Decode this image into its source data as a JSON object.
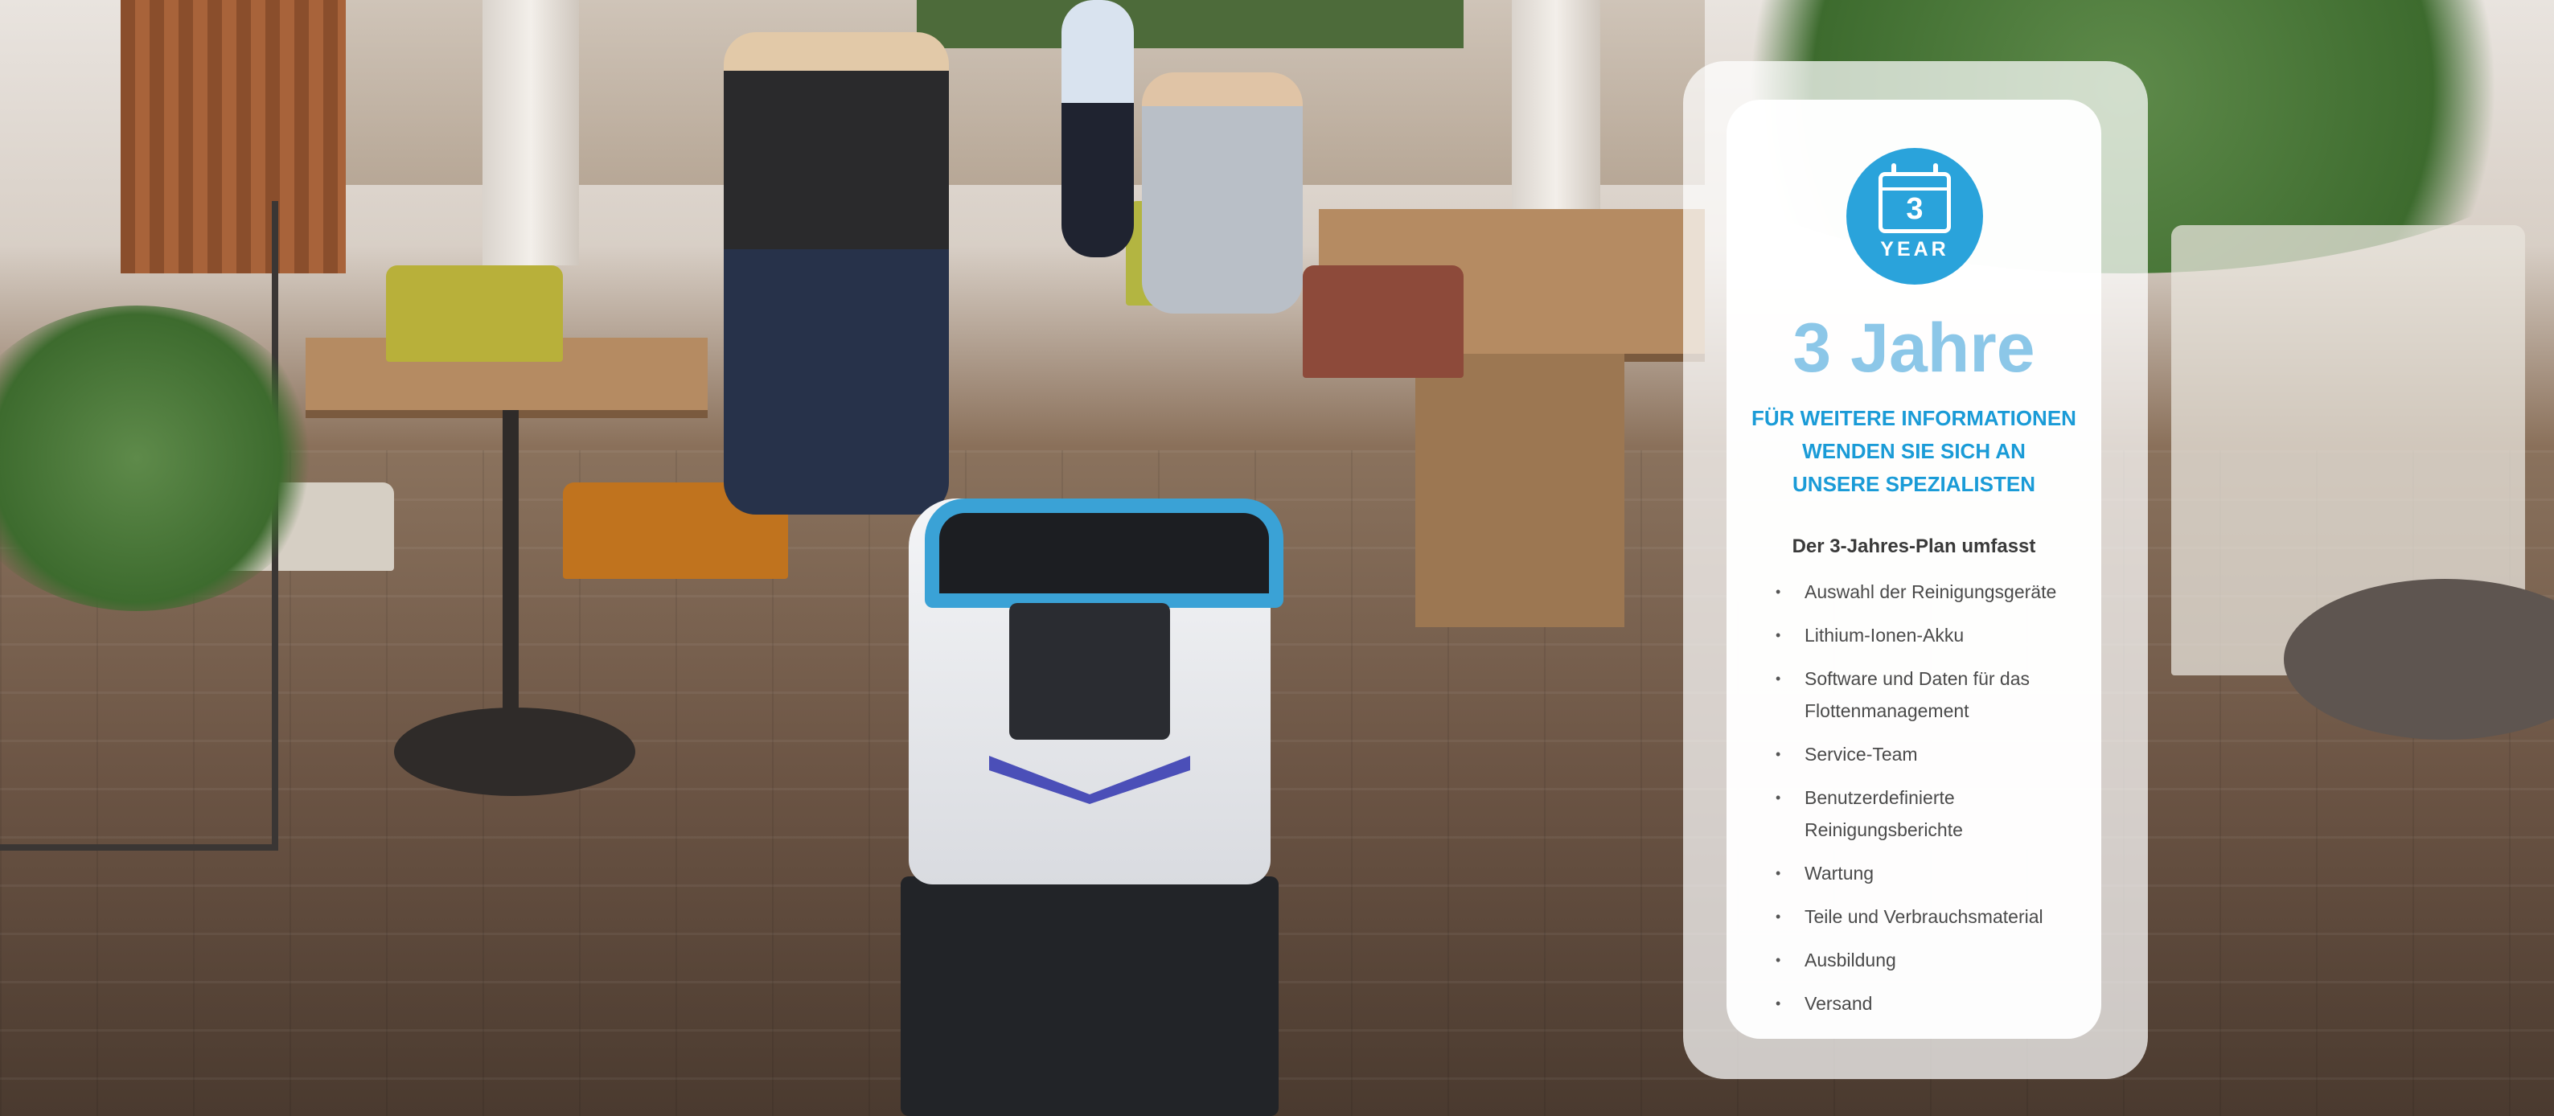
{
  "card": {
    "badge": {
      "icon": "calendar-icon",
      "number": "3",
      "label": "YEAR",
      "color": "#2aa3db"
    },
    "title": "3 Jahre",
    "headline_lines": [
      "FÜR WEITERE INFORMATIONEN",
      "WENDEN SIE SICH AN",
      "UNSERE SPEZIALISTEN"
    ],
    "plan_label": "Der 3-Jahres-Plan umfasst",
    "features": [
      "Auswahl der Reinigungsgeräte",
      "Lithium-Ionen-Akku",
      "Software und Daten für das Flottenmanagement",
      "Service-Team",
      "Benutzerdefinierte Reinigungsberichte",
      "Wartung",
      "Teile und Verbrauchsmaterial",
      "Ausbildung",
      "Versand"
    ],
    "colors": {
      "title": "#8cc7e8",
      "headline": "#1a9bd7",
      "text": "#4a4a4a"
    }
  }
}
